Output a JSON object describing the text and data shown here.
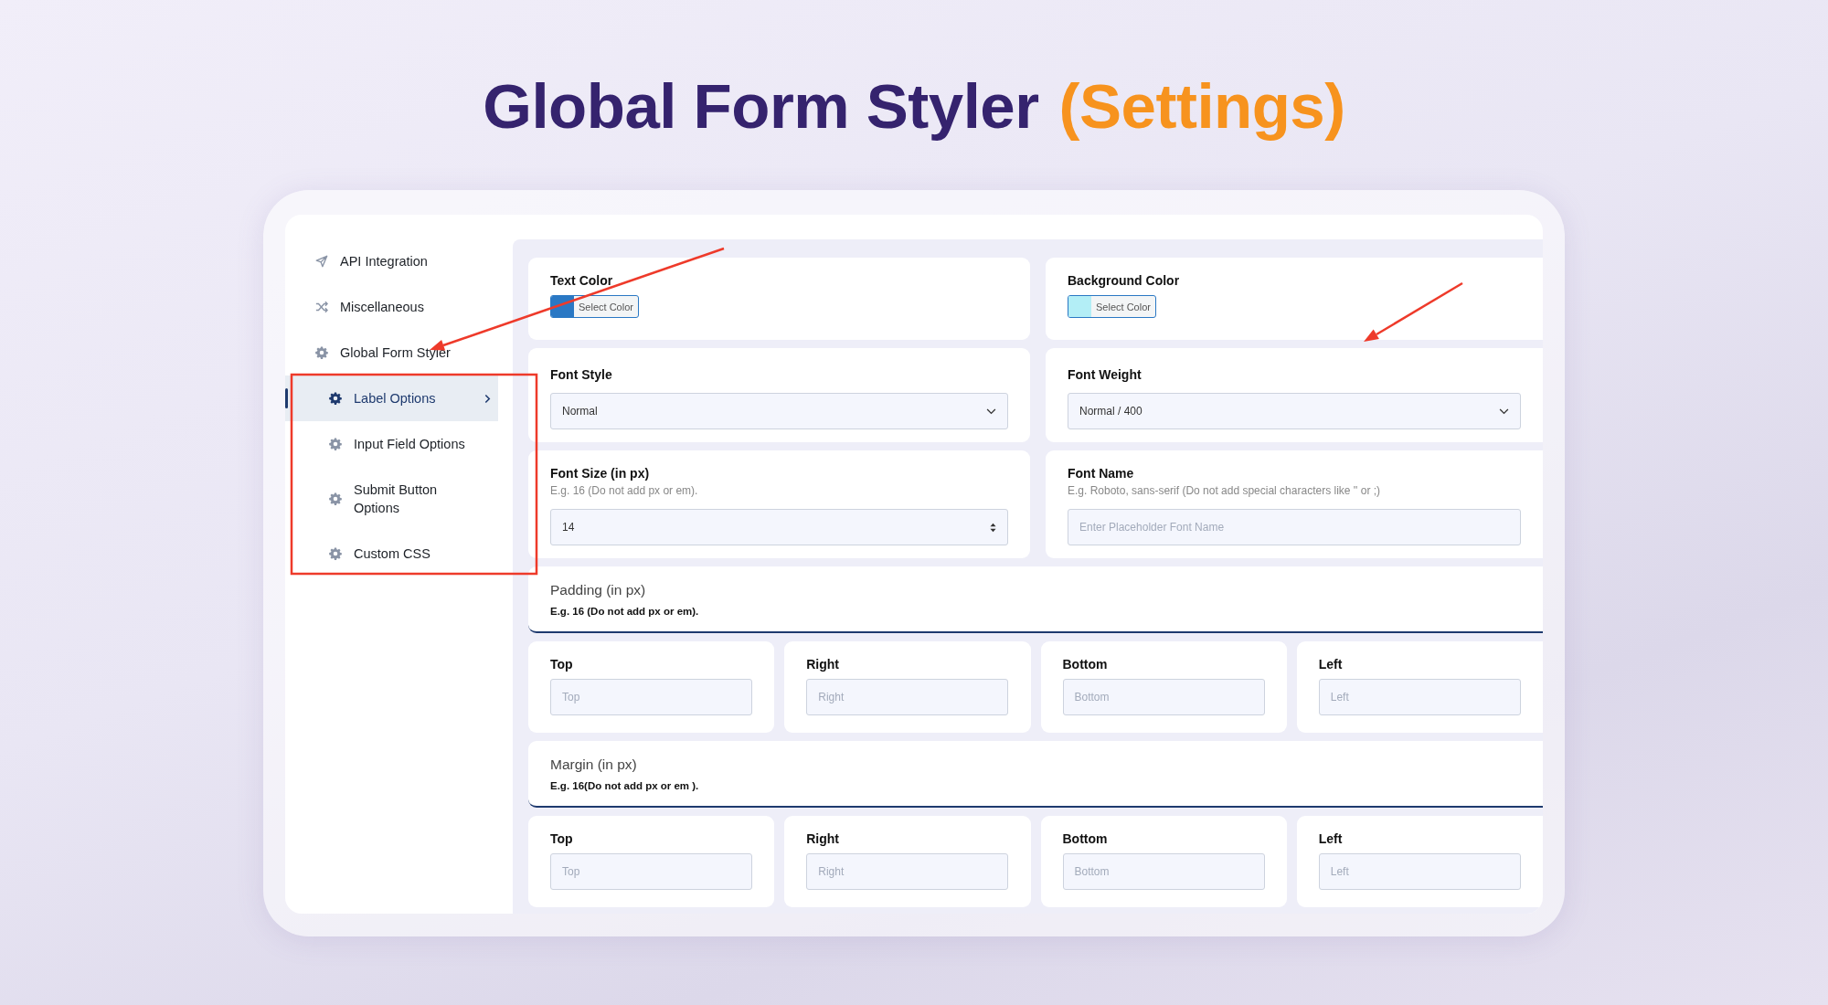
{
  "title": {
    "text": "Global Form Styler",
    "highlight": "(Settings)"
  },
  "sidebar": {
    "items": [
      {
        "label": "API Integration",
        "selected": false
      },
      {
        "label": "Miscellaneous",
        "selected": false
      },
      {
        "label": "Global Form Styler",
        "selected": false,
        "expanded": true,
        "children": [
          {
            "label": "Label Options",
            "selected": true
          },
          {
            "label": "Input Field Options",
            "selected": false
          },
          {
            "label": "Submit Button Options",
            "selected": false
          },
          {
            "label": "Custom CSS",
            "selected": false
          }
        ]
      }
    ]
  },
  "color_fields": [
    {
      "label": "Text Color",
      "button": "Select Color",
      "color": "#2a78c4"
    },
    {
      "label": "Background Color",
      "button": "Select Color",
      "color": "#b3eef6"
    }
  ],
  "selects": [
    {
      "label": "Font Style",
      "value": "Normal"
    },
    {
      "label": "Font Weight",
      "value": "Normal / 400"
    }
  ],
  "font_size": {
    "label": "Font Size (in px)",
    "hint": "E.g. 16 (Do not add px or em).",
    "value": "14"
  },
  "font_name": {
    "label": "Font Name",
    "hint": "E.g. Roboto, sans-serif (Do not add special characters like '' or ;)",
    "placeholder": "Enter Placeholder Font Name"
  },
  "spacing_groups": [
    {
      "title": "Padding (in px)",
      "hint": "E.g. 16 (Do not add px or em).",
      "fields": [
        {
          "label": "Top",
          "placeholder": "Top"
        },
        {
          "label": "Right",
          "placeholder": "Right"
        },
        {
          "label": "Bottom",
          "placeholder": "Bottom"
        },
        {
          "label": "Left",
          "placeholder": "Left"
        }
      ]
    },
    {
      "title": "Margin (in px)",
      "hint": "E.g. 16(Do not add px or em ).",
      "fields": [
        {
          "label": "Top",
          "placeholder": "Top"
        },
        {
          "label": "Right",
          "placeholder": "Right"
        },
        {
          "label": "Bottom",
          "placeholder": "Bottom"
        },
        {
          "label": "Left",
          "placeholder": "Left"
        }
      ]
    }
  ]
}
